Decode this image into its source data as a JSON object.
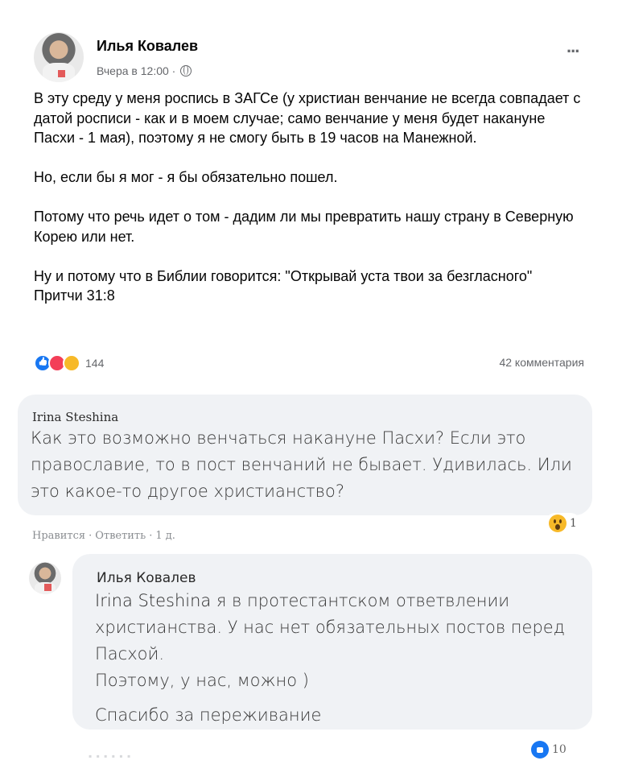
{
  "post": {
    "author": "Илья Ковалев",
    "timestamp": "Вчера в 12:00 ·",
    "privacy_icon": "globe-icon",
    "more_label": "...",
    "paragraphs": [
      "В эту среду у меня роспись в ЗАГСе (у христиан венчание не всегда совпадает с датой росписи - как и в моем случае; само венчание у меня будет накануне Пасхи - 1 мая), поэтому я не смогу быть в 19 часов на Манежной.",
      "Но, если бы я мог - я бы обязательно пошел.",
      "Потому что речь идет о том - дадим ли мы превратить нашу страну в Северную Корею или нет.",
      "Ну и потому что в Библии говорится: \"Открывай уста твои за безгласного\" Притчи 31:8"
    ],
    "reactions": {
      "icons": [
        "like-icon",
        "love-icon",
        "care-icon"
      ],
      "count": "144"
    },
    "comment_count": "42 комментария"
  },
  "comment1": {
    "author": "Irina Steshina",
    "text": "Как это возможно венчаться накануне Пасхи? Если это православие, то в пост венчаний не бывает. Удивилась. Или это какое-то другое христианство?",
    "reaction_icon": "wow-icon",
    "reaction_count": "1",
    "actions": {
      "like": "Нравится",
      "reply": "Ответить",
      "time": "1 д."
    }
  },
  "comment2": {
    "author": "Илья Ковалев",
    "mention": "Irina Steshina",
    "text": "я в протестантском ответвлении христианства. У нас нет обязательных постов перед Пасхой.",
    "text2": "Поэтому, у нас, можно )",
    "thanks": "Спасибо за переживание",
    "reaction_icon": "like-icon",
    "reaction_count": "10"
  },
  "colors": {
    "bubble": "#f0f2f5",
    "meta": "#65676b",
    "like": "#1877f2",
    "love": "#f33e58",
    "care": "#f7b928"
  }
}
